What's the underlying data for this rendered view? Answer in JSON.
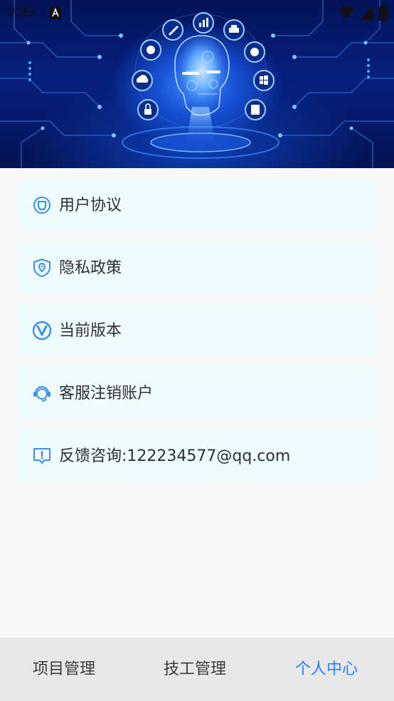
{
  "status_bar": {
    "time": "9:39",
    "icons": [
      "notification-a-icon",
      "wifi-icon",
      "signal-icon",
      "battery-icon"
    ]
  },
  "banner": {
    "theme": "ai-robot-head-technology",
    "orbit_icons": [
      "lock-icon",
      "cloud-download-icon",
      "planet-icon",
      "edit-icon",
      "bar-chart-icon",
      "printer-icon",
      "gear-icon",
      "windows-icon",
      "document-icon"
    ]
  },
  "menu": {
    "items": [
      {
        "label": "用户协议",
        "icon": "agreement-icon"
      },
      {
        "label": "隐私政策",
        "icon": "shield-location-icon"
      },
      {
        "label": "当前版本",
        "icon": "version-v-icon"
      },
      {
        "label": "客服注销账户",
        "icon": "headset-icon"
      },
      {
        "label": "反馈咨询:122234577@qq.com",
        "icon": "feedback-icon"
      }
    ]
  },
  "tabbar": {
    "tabs": [
      {
        "label": "项目管理",
        "active": false
      },
      {
        "label": "技工管理",
        "active": false
      },
      {
        "label": "个人中心",
        "active": true
      }
    ]
  },
  "colors": {
    "accent": "#2a7fff",
    "icon_blue": "#3b8fe8",
    "card_bg": "#f0fdfe",
    "page_bg": "#f8f8f8",
    "tabbar_bg": "#e8e8e8",
    "banner_dark": "#041256"
  }
}
